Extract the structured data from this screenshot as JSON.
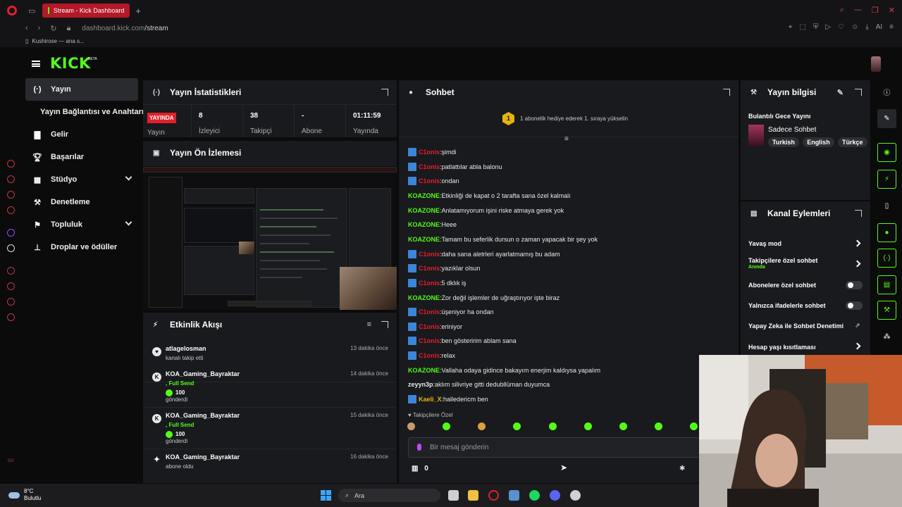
{
  "browser": {
    "tab_title": "Stream - Kick Dashboard",
    "url_domain": "dashboard.kick.com",
    "url_path": "/stream",
    "bookmark": "Kushirose — ana s...",
    "ai_label": "AI"
  },
  "header": {
    "logo": "KICK",
    "beta": "BETA"
  },
  "nav": [
    {
      "label": "Yayın",
      "icon": "broadcast-icon",
      "active": true
    },
    {
      "label": "Yayın Bağlantısı ve Anahtarı",
      "icon": "",
      "sub": true
    },
    {
      "label": "Gelir",
      "icon": "chart-icon"
    },
    {
      "label": "Başarılar",
      "icon": "trophy-icon"
    },
    {
      "label": "Stüdyo",
      "icon": "studio-icon",
      "chevron": true
    },
    {
      "label": "Denetleme",
      "icon": "wrench-icon"
    },
    {
      "label": "Topluluk",
      "icon": "community-icon",
      "chevron": true
    },
    {
      "label": "Droplar ve ödüller",
      "icon": "drops-icon"
    }
  ],
  "stats_panel": {
    "title": "Yayın İstatistikleri",
    "live_badge": "YAYINDA",
    "items": [
      {
        "value": "",
        "label": "Yayın"
      },
      {
        "value": "8",
        "label": "İzleyici"
      },
      {
        "value": "38",
        "label": "Takipçi"
      },
      {
        "value": "-",
        "label": "Abone"
      },
      {
        "value": "01:11:59",
        "label": "Yayında"
      }
    ]
  },
  "preview_panel": {
    "title": "Yayın Ön İzlemesi"
  },
  "feed_panel": {
    "title": "Etkinlik Akışı",
    "items": [
      {
        "user": "atlagelosman",
        "time": "13 dakika önce",
        "action": "kanalı takip etti"
      },
      {
        "user": "KOA_Gaming_Bayraktar",
        "time": "14 dakika önce",
        "prefix": ", Full Send",
        "amount": "100",
        "action": "gönderdi"
      },
      {
        "user": "KOA_Gaming_Bayraktar",
        "time": "15 dakika önce",
        "prefix": ", Full Send",
        "amount": "100",
        "action": "gönderdi"
      },
      {
        "user": "KOA_Gaming_Bayraktar",
        "time": "16 dakika önce",
        "action": "abone oldu"
      }
    ]
  },
  "chat_panel": {
    "title": "Sohbet",
    "gift_number": "1",
    "gift_text": "1 abonelik hediye ederek 1. sıraya yükselin",
    "messages": [
      {
        "user": "C1onis",
        "color": "#e0202b",
        "badge": true,
        "text": "şimdi"
      },
      {
        "user": "C1onis",
        "color": "#e0202b",
        "badge": true,
        "text": "patlattılar abla balonu"
      },
      {
        "user": "C1onis",
        "color": "#e0202b",
        "badge": true,
        "text": "ondan"
      },
      {
        "user": "KOAZONE",
        "color": "#53fc18",
        "badge": false,
        "text": "Etkinliği de kapat o 2 tarafta sana özel kalmalı"
      },
      {
        "user": "KOAZONE",
        "color": "#53fc18",
        "badge": false,
        "text": "Anlatamıyorum işini riske atmaya gerek yok"
      },
      {
        "user": "KOAZONE",
        "color": "#53fc18",
        "badge": false,
        "text": "Heee"
      },
      {
        "user": "KOAZONE",
        "color": "#53fc18",
        "badge": false,
        "text": "Tamam bu seferlik dursun o zaman yapacak bir şey yok"
      },
      {
        "user": "C1onis",
        "color": "#e0202b",
        "badge": true,
        "text": "daha sana aletrleri ayarlatmamış bu adam"
      },
      {
        "user": "C1onis",
        "color": "#e0202b",
        "badge": true,
        "text": "yazıklar olsun"
      },
      {
        "user": "C1onis",
        "color": "#e0202b",
        "badge": true,
        "text": "5 dklık iş"
      },
      {
        "user": "KOAZONE",
        "color": "#53fc18",
        "badge": false,
        "text": "Zor değil işlemler de uğraştırıyor işte biraz"
      },
      {
        "user": "C1onis",
        "color": "#e0202b",
        "badge": true,
        "text": "üşeniyor ha ondan"
      },
      {
        "user": "C1onis",
        "color": "#e0202b",
        "badge": true,
        "text": "eriniyor"
      },
      {
        "user": "C1onis",
        "color": "#e0202b",
        "badge": true,
        "text": "ben gösteririm ablam sana"
      },
      {
        "user": "C1onis",
        "color": "#e0202b",
        "badge": true,
        "text": "relax"
      },
      {
        "user": "KOAZONE",
        "color": "#53fc18",
        "badge": false,
        "text": "Vallaha odaya gidince bakayım enerjim kaldıysa yapalım"
      },
      {
        "user": "zeyyn3p",
        "color": "#e8e8e8",
        "badge": false,
        "text": "aklım silivriye gitti dedubllüman duyumca"
      },
      {
        "user": "Kaeli_X",
        "color": "#e6b410",
        "badge": true,
        "text": "halledericm ben"
      }
    ],
    "followers_only": "Takipçilere Özel",
    "input_placeholder": "Bir mesaj gönderin",
    "points": "0"
  },
  "stream_info": {
    "title": "Yayın bilgisi",
    "stream_title": "Bulantılı Gece Yayını",
    "category": "Sadece Sohbet",
    "tags": [
      "Turkish",
      "English",
      "Türkçe"
    ]
  },
  "channel_actions": {
    "title": "Kanal Eylemleri",
    "items": [
      {
        "label": "Yavaş mod",
        "type": "chevron"
      },
      {
        "label": "Takipçilere özel sohbet",
        "sub": "Anında",
        "type": "chevron"
      },
      {
        "label": "Abonelere özel sohbet",
        "type": "toggle"
      },
      {
        "label": "Yalnızca ifadelerle sohbet",
        "type": "toggle"
      },
      {
        "label": "Yapay Zeka ile Sohbet Denetimi",
        "type": "external"
      },
      {
        "label": "Hesap yaşı kısıtlaması",
        "type": "chevron"
      }
    ]
  },
  "taskbar": {
    "temp": "8°C",
    "weather": "Bulutlu",
    "search": "Ara"
  },
  "colors": {
    "accent": "#53fc18",
    "live": "#e0202b",
    "panel": "#191a1d"
  }
}
